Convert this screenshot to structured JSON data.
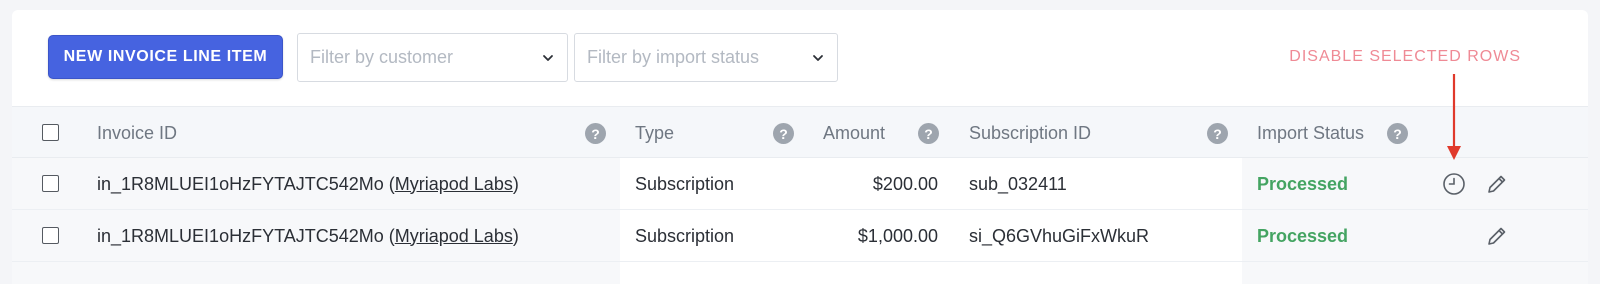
{
  "toolbar": {
    "new_button_label": "NEW INVOICE LINE ITEM",
    "customer_filter_placeholder": "Filter by customer",
    "import_filter_placeholder": "Filter by import status",
    "disable_selected_label": "DISABLE SELECTED ROWS"
  },
  "table": {
    "headers": {
      "invoice_id": "Invoice ID",
      "type": "Type",
      "amount": "Amount",
      "subscription_id": "Subscription ID",
      "import_status": "Import Status"
    },
    "help_glyph": "?",
    "rows": [
      {
        "invoice_prefix": "in_1R8MLUEI1oHzFYTAJTC542Mo (",
        "customer": "Myriapod Labs",
        "invoice_suffix": ")",
        "type": "Subscription",
        "amount": "$200.00",
        "subscription_id": "sub_032411",
        "import_status": "Processed",
        "actions": [
          "clock-icon",
          "pencil-icon"
        ]
      },
      {
        "invoice_prefix": "in_1R8MLUEI1oHzFYTAJTC542Mo (",
        "customer": "Myriapod Labs",
        "invoice_suffix": ")",
        "type": "Subscription",
        "amount": "$1,000.00",
        "subscription_id": "si_Q6GVhuGiFxWkuR",
        "import_status": "Processed",
        "actions": [
          "pencil-icon"
        ]
      }
    ]
  },
  "colors": {
    "primary": "#4663e0",
    "danger_link": "#ef8a95",
    "arrow": "#e0392b",
    "status_processed": "#44a462"
  }
}
